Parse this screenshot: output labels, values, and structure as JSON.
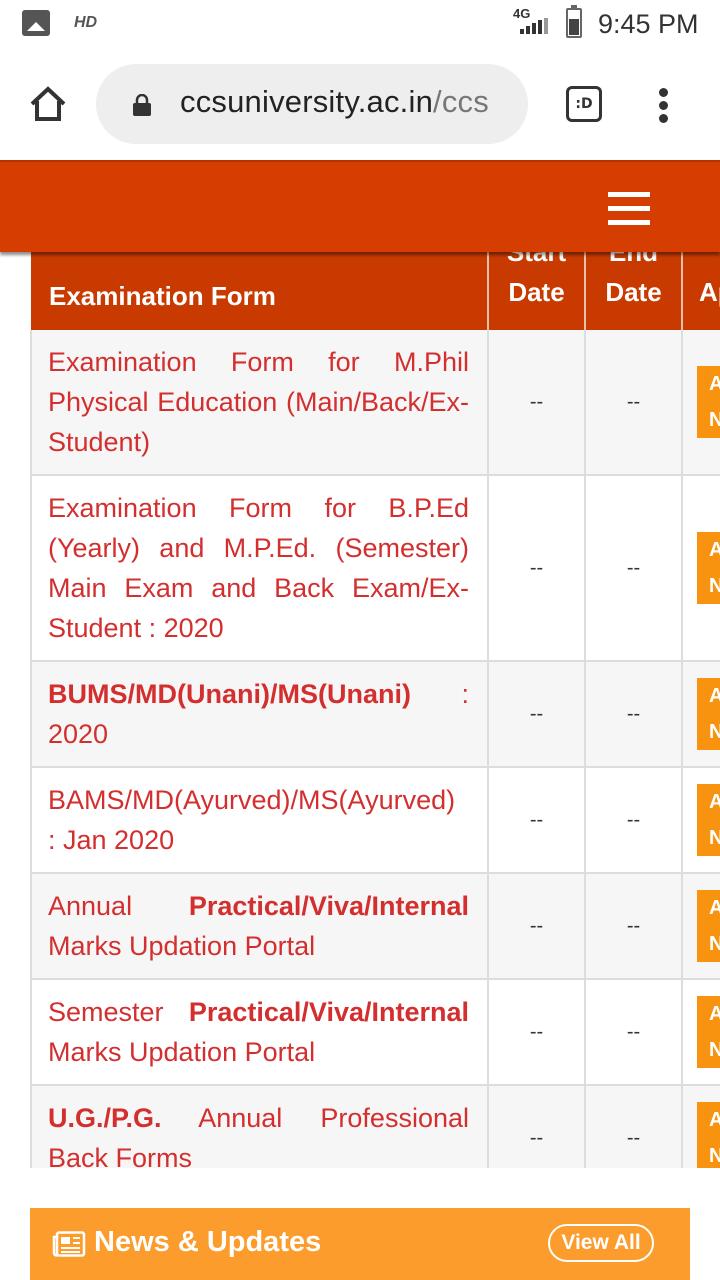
{
  "status_bar": {
    "hd_label": "HD",
    "network": "4G",
    "time": "9:45 PM"
  },
  "browser": {
    "url_domain": "ccsuniversity.ac.in",
    "url_path": "/ccs",
    "tabs_label": ":D"
  },
  "table": {
    "headers": {
      "form": "Examination Form",
      "start_top": "Start",
      "start_bottom": "Date",
      "end_top": "End",
      "end_bottom": "Date",
      "apply": "Ap"
    },
    "rows": [
      {
        "plain_before": "Examination Form for M.Phil Physical Education (Main/Back/Ex-Student)",
        "bold": "",
        "plain_after": "",
        "start": "--",
        "end": "--",
        "btn_top": "A",
        "btn_bottom": "N"
      },
      {
        "plain_before": "Examination Form for B.P.Ed (Yearly) and M.P.Ed. (Semester) Main Exam and Back Exam/Ex-Student : 2020",
        "bold": "",
        "plain_after": "",
        "start": "--",
        "end": "--",
        "btn_top": "A",
        "btn_bottom": "N"
      },
      {
        "plain_before": "",
        "bold": "BUMS/MD(Unani)/MS(Unani)",
        "plain_after": " : 2020",
        "start": "--",
        "end": "--",
        "btn_top": "A",
        "btn_bottom": "N"
      },
      {
        "plain_before": "BAMS/MD(Ayurved)/MS(Ayurved) : Jan 2020",
        "bold": "",
        "plain_after": "",
        "start": "--",
        "end": "--",
        "btn_top": "A",
        "btn_bottom": "N"
      },
      {
        "plain_before": "Annual ",
        "bold": "Practical/Viva/Internal",
        "plain_after": " Marks Updation Portal",
        "start": "--",
        "end": "--",
        "btn_top": "A",
        "btn_bottom": "N"
      },
      {
        "plain_before": "Semester ",
        "bold": "Practical/Viva/Internal",
        "plain_after": " Marks Updation Portal",
        "start": "--",
        "end": "--",
        "btn_top": "A",
        "btn_bottom": "N"
      },
      {
        "plain_before": "",
        "bold": "U.G./P.G.",
        "plain_after": " Annual Professional Back Forms",
        "start": "--",
        "end": "--",
        "btn_top": "A",
        "btn_bottom": "N"
      }
    ]
  },
  "news": {
    "title": "News & Updates",
    "view_all": "View All"
  },
  "colors": {
    "header_orange": "#d53e00",
    "table_header": "#c83a00",
    "link_red": "#d32f2f",
    "apply_button": "#f7930e",
    "news_bar": "#fb9c2c"
  }
}
